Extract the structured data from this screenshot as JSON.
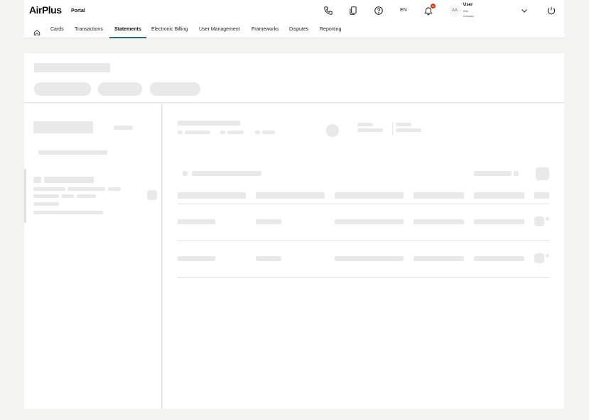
{
  "header": {
    "logo": "AirPlus",
    "portal_label": "Portal",
    "icons": [
      "phone-icon",
      "copy-icon",
      "help-icon",
      "bell-icon",
      "chevron-down-icon",
      "power-icon"
    ],
    "language": "EN",
    "notification_count": "5",
    "user": {
      "initials": "AA",
      "name": "User",
      "role": "Role",
      "company": "Company"
    }
  },
  "nav": {
    "home_icon": "home-icon",
    "tabs": [
      {
        "label": "Cards"
      },
      {
        "label": "Transactions"
      },
      {
        "label": "Statements"
      },
      {
        "label": "Electronic Billing"
      },
      {
        "label": "User Management"
      },
      {
        "label": "Frameworks"
      },
      {
        "label": "Disputes"
      },
      {
        "label": "Reporting"
      }
    ],
    "active_tab": "Statements"
  },
  "colors": {
    "page_background": "#f3f3f1",
    "panel_background": "#ffffff",
    "skeleton": "#e9e9e9",
    "active_tab_underline": "#2a6b6b",
    "notification_badge": "#d2401c"
  }
}
